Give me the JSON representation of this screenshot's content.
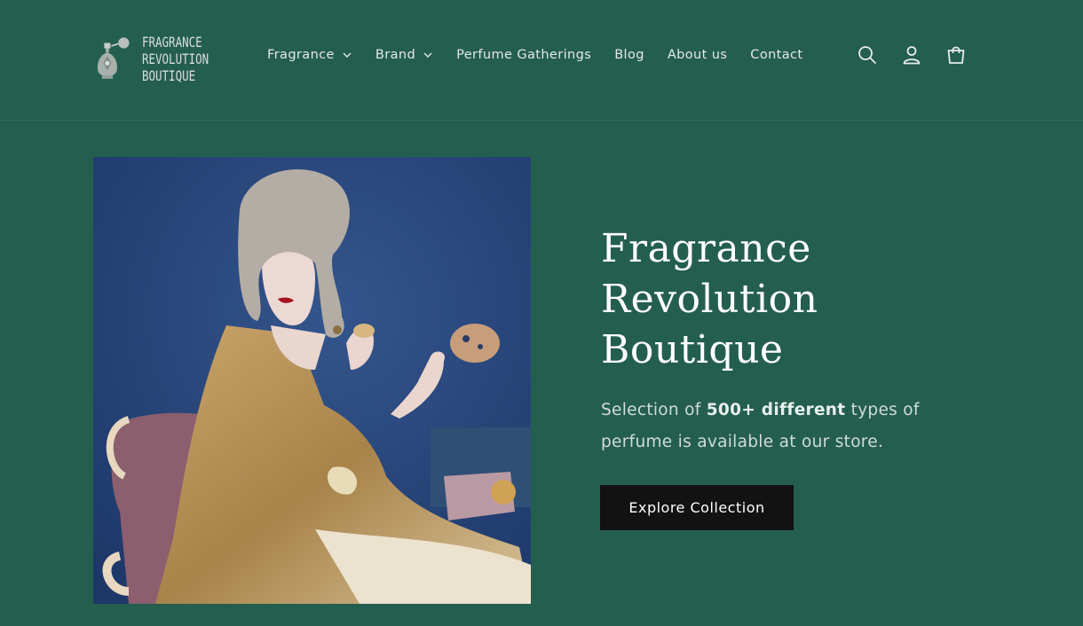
{
  "brand": {
    "logo_lines": [
      "FRAGRANCE",
      "REVOLUTION",
      "BOUTIQUE"
    ]
  },
  "nav": {
    "items": [
      {
        "label": "Fragrance",
        "dropdown": true
      },
      {
        "label": "Brand",
        "dropdown": true
      },
      {
        "label": "Perfume Gatherings",
        "dropdown": false
      },
      {
        "label": "Blog",
        "dropdown": false
      },
      {
        "label": "About us",
        "dropdown": false
      },
      {
        "label": "Contact",
        "dropdown": false
      }
    ]
  },
  "header_icons": [
    "search-icon",
    "account-icon",
    "cart-icon"
  ],
  "hero": {
    "title_lines": [
      "Fragrance",
      "Revolution",
      "Boutique"
    ],
    "desc_prefix": "Selection of ",
    "desc_bold": "500+ different",
    "desc_suffix": " types of perfume is available at our store.",
    "cta_label": "Explore Collection"
  },
  "colors": {
    "background": "#245e4f",
    "button": "#121212",
    "image_backdrop": "#2b4a7e"
  }
}
